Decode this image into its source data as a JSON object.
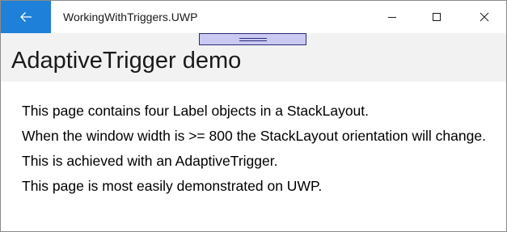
{
  "window": {
    "title": "WorkingWithTriggers.UWP",
    "accent_color": "#1e80d8"
  },
  "titlebar": {
    "back_icon": "arrow-left-icon",
    "minimize_icon": "minimize-icon",
    "maximize_icon": "maximize-icon",
    "close_icon": "close-icon"
  },
  "header": {
    "title": "AdaptiveTrigger demo"
  },
  "labels": [
    "This page contains four Label objects in a StackLayout.",
    "When the window width is >= 800 the StackLayout orientation will change.",
    "This is achieved with an AdaptiveTrigger.",
    "This page is most easily demonstrated on UWP."
  ]
}
